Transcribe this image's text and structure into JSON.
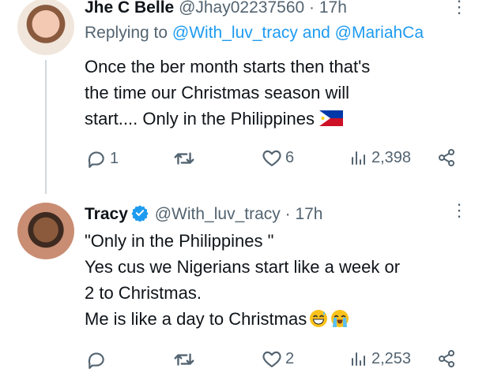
{
  "tweets": [
    {
      "name": "Jhe C Belle",
      "handle": "@Jhay02237560",
      "dot": "·",
      "time": "17h",
      "replying_label": "Replying to",
      "replying_mentions": [
        "@With_luv_tracy",
        "@MariahCa"
      ],
      "replying_and": "and",
      "body_lines": [
        "Once the ber month starts then that's",
        "the time our Christmas season will",
        "start.... Only in the Philippines"
      ],
      "body_emoji": "philippines-flag",
      "replies": "1",
      "retweets": "",
      "likes": "6",
      "views": "2,398"
    },
    {
      "name": "Tracy",
      "verified": true,
      "handle": "@With_luv_tracy",
      "dot": "·",
      "time": "17h",
      "body_lines": [
        "\"Only in the Philippines \"",
        "Yes cus we Nigerians start like a week or",
        "2 to Christmas.",
        "Me is like a day to Christmas"
      ],
      "body_emoji": [
        "sweat-smile-emoji",
        "loudly-crying-emoji"
      ],
      "replies": "",
      "retweets": "",
      "likes": "2",
      "views": "2,253"
    }
  ],
  "icons": {
    "more": "more-vertical-icon",
    "reply": "reply-icon",
    "retweet": "retweet-icon",
    "like": "heart-icon",
    "views": "views-icon",
    "share": "share-icon"
  },
  "colors": {
    "link": "#1d9bf0",
    "secondary": "#536471",
    "text": "#0f1419",
    "verified": "#1d9bf0"
  }
}
